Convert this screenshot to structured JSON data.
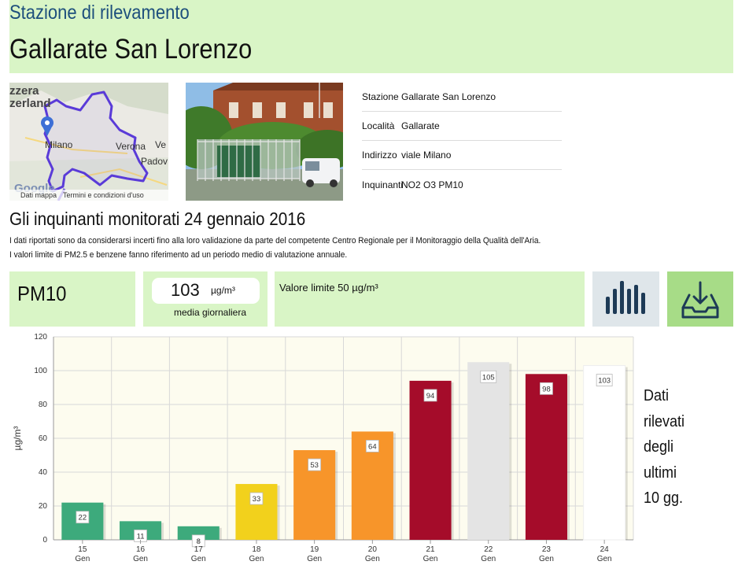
{
  "header": {
    "subtitle": "Stazione di rilevamento",
    "title": "Gallarate San Lorenzo"
  },
  "map": {
    "labels": [
      "zzera",
      "zerland",
      "Milano",
      "Verona",
      "Ve",
      "Padov"
    ],
    "footer_data": "Dati mappa",
    "footer_terms": "Termini e condizioni d'uso",
    "google": "Google"
  },
  "info": {
    "rows": [
      {
        "key": "Stazione",
        "value": "Gallarate San Lorenzo"
      },
      {
        "key": "Località",
        "value": "Gallarate"
      },
      {
        "key": "Indirizzo",
        "value": "viale Milano"
      },
      {
        "key": "Inquinanti",
        "value": "NO2 O3 PM10"
      }
    ]
  },
  "section": {
    "title": "Gli inquinanti monitorati 24 gennaio 2016",
    "note1": "I dati riportati sono da considerarsi incerti fino alla loro validazione da parte del competente Centro Regionale per il Monitoraggio della Qualità dell'Aria.",
    "note2": "I valori limite di PM2.5 e benzene fanno riferimento ad un periodo medio di valutazione annuale."
  },
  "pollutant": {
    "name": "PM10",
    "value": "103",
    "unit": "µg/m³",
    "value_caption": "media giornaliera",
    "limit": "Valore limite 50 µg/m³"
  },
  "icons": {
    "chart": "bar-chart-icon",
    "download": "download-tray-icon",
    "colors": {
      "chart_bg": "#dfe6ea",
      "chart_fg": "#1d3a56",
      "download_bg": "#a7dc87",
      "download_fg": "#1d3a56"
    }
  },
  "side_text": [
    "Dati",
    "rilevati",
    "degli",
    "ultimi",
    "10 gg."
  ],
  "chart_data": {
    "type": "bar",
    "categories": [
      "15",
      "16",
      "17",
      "18",
      "19",
      "20",
      "21",
      "22",
      "23",
      "24"
    ],
    "category_sub": [
      "Gen",
      "Gen",
      "Gen",
      "Gen",
      "Gen",
      "Gen",
      "Gen",
      "Gen",
      "Gen",
      "Gen"
    ],
    "values": [
      22,
      11,
      8,
      33,
      53,
      64,
      94,
      105,
      98,
      103
    ],
    "colors": [
      "#3daa7c",
      "#3daa7c",
      "#3daa7c",
      "#f2d11c",
      "#f7952a",
      "#f7952a",
      "#a50c2a",
      "#e4e4e4",
      "#a50c2a",
      "#ffffff"
    ],
    "ylabel": "µg/m³",
    "ylim": [
      0,
      120
    ],
    "yticks": [
      0,
      20,
      40,
      60,
      80,
      100,
      120
    ],
    "grid": true,
    "plot_bg": "#fdfcef"
  }
}
